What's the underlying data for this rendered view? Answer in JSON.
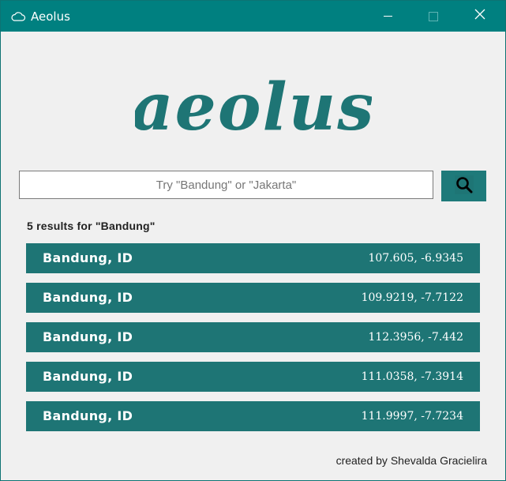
{
  "window": {
    "title": "Aeolus",
    "icon": "cloud-icon",
    "controls": [
      "minimize-icon",
      "maximize-icon",
      "close-icon"
    ]
  },
  "logo": {
    "text": "aeolus",
    "color": "#1e7575"
  },
  "search": {
    "value": "",
    "placeholder": "Try \"Bandung\" or \"Jakarta\"",
    "button_icon": "search-icon"
  },
  "results": {
    "heading": "5 results for \"Bandung\"",
    "items": [
      {
        "name": "Bandung, ID",
        "coords": "107.605, -6.9345"
      },
      {
        "name": "Bandung, ID",
        "coords": "109.9219, -7.7122"
      },
      {
        "name": "Bandung, ID",
        "coords": "112.3956, -7.442"
      },
      {
        "name": "Bandung, ID",
        "coords": "111.0358, -7.3914"
      },
      {
        "name": "Bandung, ID",
        "coords": "111.9997, -7.7234"
      }
    ]
  },
  "footer": {
    "credit": "created by Shevalda Gracielira"
  },
  "colors": {
    "titlebar": "#008080",
    "accent": "#1e7575",
    "background": "#f0f0f0"
  }
}
